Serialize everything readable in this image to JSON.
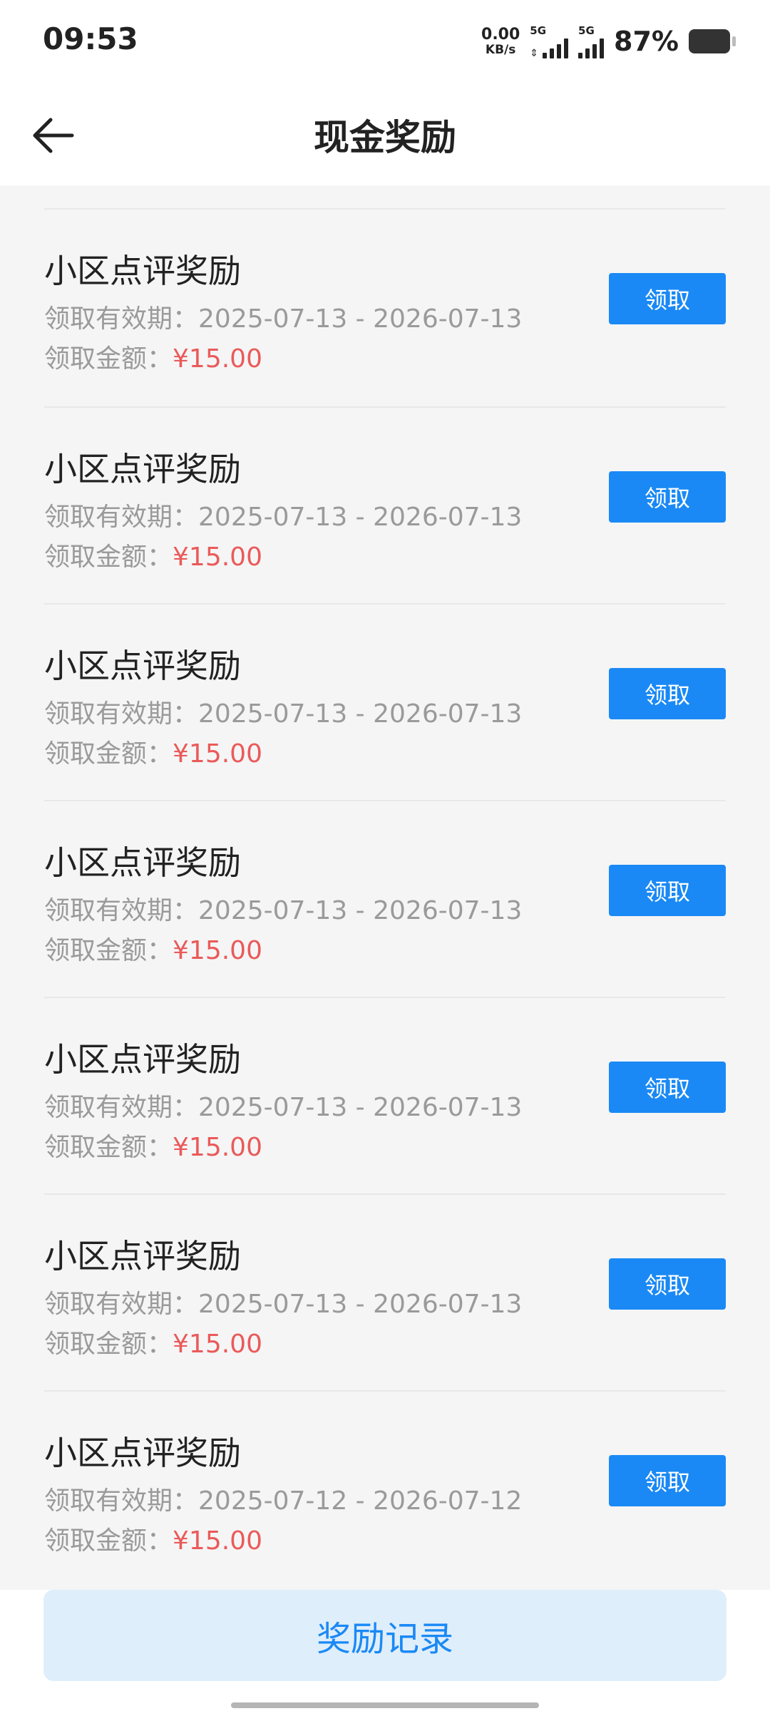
{
  "status_bar": {
    "time": "09:53",
    "net_speed_value": "0.00",
    "net_speed_unit": "KB/s",
    "sim1_label": "5G",
    "sim2_label": "5G",
    "battery_percent": "87%",
    "battery_level": 0.87
  },
  "header": {
    "back_icon": "arrow-left-icon",
    "title": "现金奖励"
  },
  "rewards": [
    {
      "title": "小区点评奖励",
      "period_label": "领取有效期：",
      "period": "2025-07-13 - 2026-07-13",
      "amount_label": "领取金额：",
      "amount": "¥15.00",
      "button": "领取"
    },
    {
      "title": "小区点评奖励",
      "period_label": "领取有效期：",
      "period": "2025-07-13 - 2026-07-13",
      "amount_label": "领取金额：",
      "amount": "¥15.00",
      "button": "领取"
    },
    {
      "title": "小区点评奖励",
      "period_label": "领取有效期：",
      "period": "2025-07-13 - 2026-07-13",
      "amount_label": "领取金额：",
      "amount": "¥15.00",
      "button": "领取"
    },
    {
      "title": "小区点评奖励",
      "period_label": "领取有效期：",
      "period": "2025-07-13 - 2026-07-13",
      "amount_label": "领取金额：",
      "amount": "¥15.00",
      "button": "领取"
    },
    {
      "title": "小区点评奖励",
      "period_label": "领取有效期：",
      "period": "2025-07-13 - 2026-07-13",
      "amount_label": "领取金额：",
      "amount": "¥15.00",
      "button": "领取"
    },
    {
      "title": "小区点评奖励",
      "period_label": "领取有效期：",
      "period": "2025-07-13 - 2026-07-13",
      "amount_label": "领取金额：",
      "amount": "¥15.00",
      "button": "领取"
    },
    {
      "title": "小区点评奖励",
      "period_label": "领取有效期：",
      "period": "2025-07-12 - 2026-07-12",
      "amount_label": "领取金额：",
      "amount": "¥15.00",
      "button": "领取"
    }
  ],
  "footer": {
    "records_button": "奖励记录"
  },
  "colors": {
    "accent": "#1a89f5",
    "amount": "#ea5a5a",
    "records_bg": "#dfeefb"
  }
}
